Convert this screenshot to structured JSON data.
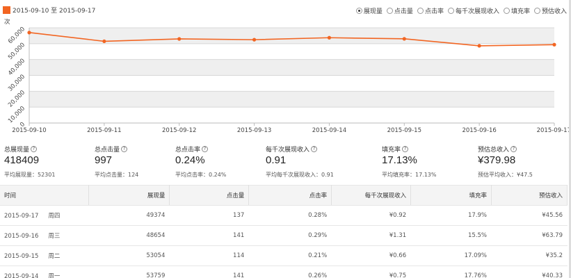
{
  "legend": {
    "date_range": "2015-09-10 至 2015-09-17",
    "color": "#f26522"
  },
  "metric_options": [
    {
      "label": "展现量",
      "selected": true
    },
    {
      "label": "点击量",
      "selected": false
    },
    {
      "label": "点击率",
      "selected": false
    },
    {
      "label": "每千次展现收入",
      "selected": false
    },
    {
      "label": "填充率",
      "selected": false
    },
    {
      "label": "预估收入",
      "selected": false
    }
  ],
  "chart_data": {
    "type": "line",
    "ylabel": "次",
    "x": [
      "2015-09-10",
      "2015-09-11",
      "2015-09-12",
      "2015-09-13",
      "2015-09-14",
      "2015-09-15",
      "2015-09-16",
      "2015-09-17"
    ],
    "y_ticks": [
      "0",
      "10,000",
      "20,000",
      "30,000",
      "40,000",
      "50,000",
      "60,000"
    ],
    "series": [
      {
        "values": [
          57000,
          51500,
          53000,
          52500,
          53759,
          53054,
          48654,
          49374
        ],
        "color": "#f26522"
      }
    ],
    "ylim": [
      0,
      60000
    ],
    "grid": true
  },
  "summary": [
    {
      "label": "总展现量",
      "value": "418409",
      "avg": "平均展现量：52301"
    },
    {
      "label": "总点击量",
      "value": "997",
      "avg": "平均点击量：124"
    },
    {
      "label": "总点击率",
      "value": "0.24%",
      "avg": "平均点击率：0.24%"
    },
    {
      "label": "每千次展现收入",
      "value": "0.91",
      "avg": "平均每千次展现收入：0.91"
    },
    {
      "label": "填充率",
      "value": "17.13%",
      "avg": "平均填充率：17.13%"
    },
    {
      "label": "预估总收入",
      "value": "¥379.98",
      "avg": "预估平均收入：¥47.5"
    }
  ],
  "help_glyph": "?",
  "table": {
    "headers": [
      "时间",
      "展现量",
      "点击量",
      "点击率",
      "每千次展现收入",
      "填充率",
      "预估收入"
    ],
    "rows": [
      {
        "date": "2015-09-17",
        "weekday": "周四",
        "cells": [
          "49374",
          "137",
          "0.28%",
          "¥0.92",
          "17.9%",
          "¥45.56"
        ]
      },
      {
        "date": "2015-09-16",
        "weekday": "周三",
        "cells": [
          "48654",
          "141",
          "0.29%",
          "¥1.31",
          "15.5%",
          "¥63.79"
        ]
      },
      {
        "date": "2015-09-15",
        "weekday": "周二",
        "cells": [
          "53054",
          "114",
          "0.21%",
          "¥0.66",
          "17.09%",
          "¥35.2"
        ]
      },
      {
        "date": "2015-09-14",
        "weekday": "周一",
        "cells": [
          "53759",
          "141",
          "0.26%",
          "¥0.75",
          "17.76%",
          "¥40.33"
        ]
      }
    ]
  }
}
